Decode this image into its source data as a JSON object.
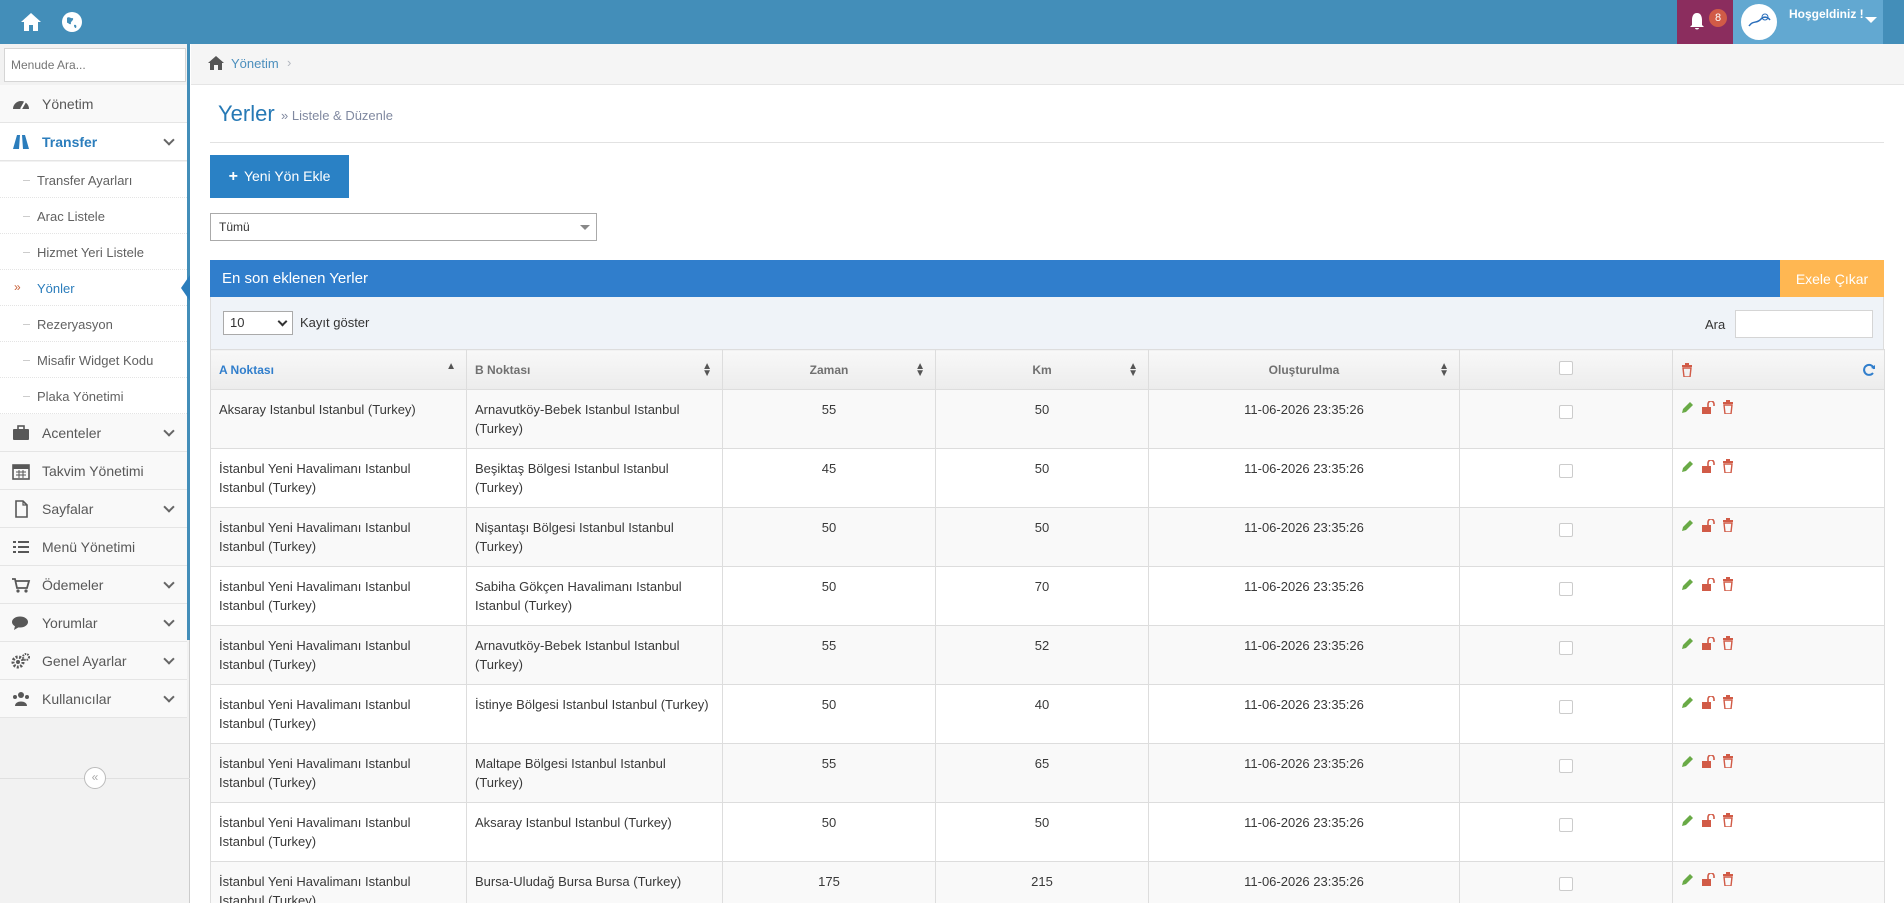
{
  "topbar": {
    "notifications": "8",
    "greeting": "Hoşgeldiniz !"
  },
  "sidebar": {
    "search_placeholder": "Menude Ara...",
    "items": [
      {
        "label": "Yönetim"
      },
      {
        "label": "Transfer"
      },
      {
        "label": "Acenteler"
      },
      {
        "label": "Takvim Yönetimi"
      },
      {
        "label": "Sayfalar"
      },
      {
        "label": "Menü Yönetimi"
      },
      {
        "label": "Ödemeler"
      },
      {
        "label": "Yorumlar"
      },
      {
        "label": "Genel Ayarlar"
      },
      {
        "label": "Kullanıcılar"
      }
    ],
    "sub_items": [
      {
        "label": "Transfer Ayarları"
      },
      {
        "label": "Arac Listele"
      },
      {
        "label": "Hizmet Yeri Listele"
      },
      {
        "label": "Yönler"
      },
      {
        "label": "Rezeryasyon"
      },
      {
        "label": "Misafir Widget Kodu"
      },
      {
        "label": "Plaka Yönetimi"
      }
    ]
  },
  "breadcrumb": {
    "home": "Yönetim"
  },
  "page": {
    "title": "Yerler",
    "subtitle": "» Listele & Düzenle",
    "add_button": "Yeni Yön Ekle",
    "filter_value": "Tümü"
  },
  "widget": {
    "title": "En son eklenen Yerler",
    "excel_button": "Exele Çıkar",
    "length_value": "10",
    "length_label": "Kayıt göster",
    "search_label": "Ara"
  },
  "table": {
    "headers": [
      "A Noktası",
      "B Noktası",
      "Zaman",
      "Km",
      "Oluşturulma"
    ],
    "rows": [
      {
        "a": "Aksaray Istanbul Istanbul (Turkey)",
        "b": "Arnavutköy-Bebek Istanbul Istanbul (Turkey)",
        "time": "55",
        "km": "50",
        "created": "11-06-2026 23:35:26"
      },
      {
        "a": "İstanbul Yeni Havalimanı Istanbul Istanbul (Turkey)",
        "b": "Beşiktaş Bölgesi Istanbul Istanbul (Turkey)",
        "time": "45",
        "km": "50",
        "created": "11-06-2026 23:35:26"
      },
      {
        "a": "İstanbul Yeni Havalimanı Istanbul Istanbul (Turkey)",
        "b": "Nişantaşı Bölgesi Istanbul Istanbul (Turkey)",
        "time": "50",
        "km": "50",
        "created": "11-06-2026 23:35:26"
      },
      {
        "a": "İstanbul Yeni Havalimanı Istanbul Istanbul (Turkey)",
        "b": "Sabiha Gökçen Havalimanı Istanbul Istanbul (Turkey)",
        "time": "50",
        "km": "70",
        "created": "11-06-2026 23:35:26"
      },
      {
        "a": "İstanbul Yeni Havalimanı Istanbul Istanbul (Turkey)",
        "b": "Arnavutköy-Bebek Istanbul Istanbul (Turkey)",
        "time": "55",
        "km": "52",
        "created": "11-06-2026 23:35:26"
      },
      {
        "a": "İstanbul Yeni Havalimanı Istanbul Istanbul (Turkey)",
        "b": "İstinye Bölgesi Istanbul Istanbul (Turkey)",
        "time": "50",
        "km": "40",
        "created": "11-06-2026 23:35:26"
      },
      {
        "a": "İstanbul Yeni Havalimanı Istanbul Istanbul (Turkey)",
        "b": "Maltape Bölgesi Istanbul Istanbul (Turkey)",
        "time": "55",
        "km": "65",
        "created": "11-06-2026 23:35:26"
      },
      {
        "a": "İstanbul Yeni Havalimanı Istanbul Istanbul (Turkey)",
        "b": "Aksaray Istanbul Istanbul (Turkey)",
        "time": "50",
        "km": "50",
        "created": "11-06-2026 23:35:26"
      },
      {
        "a": "İstanbul Yeni Havalimanı Istanbul Istanbul (Turkey)",
        "b": "Bursa-Uludağ Bursa Bursa (Turkey)",
        "time": "175",
        "km": "215",
        "created": "11-06-2026 23:35:26"
      }
    ]
  },
  "colors": {
    "topbar": "#438eb9",
    "primary": "#307ecc",
    "excel": "#ffb752",
    "edit": "#69aa46",
    "delete": "#d15b47"
  },
  "icons": {
    "top": [
      "home-icon",
      "globe-icon",
      "bell-icon"
    ],
    "row_actions": [
      "pencil-icon",
      "unlock-icon",
      "trash-icon"
    ]
  }
}
